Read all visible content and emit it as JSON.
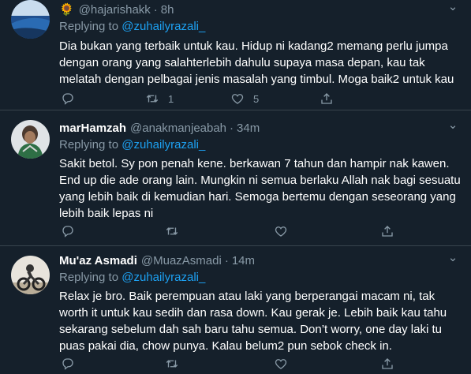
{
  "tweets": [
    {
      "emoji": "🌻",
      "name": "",
      "handle": "@hajarishakk",
      "time": "8h",
      "replying_prefix": "Replying to ",
      "replying_to": "@zuhailyrazali_",
      "text": "Dia bukan yang terbaik untuk kau. Hidup ni kadang2 memang perlu jumpa dengan orang yang salahterlebih dahulu supaya masa depan, kau tak melatah dengan pelbagai jenis masalah yang timbul. Moga baik2 untuk kau",
      "retweets": "1",
      "likes": "5"
    },
    {
      "name": "marHamzah",
      "handle": "@anakmanjeabah",
      "time": "34m",
      "replying_prefix": "Replying to ",
      "replying_to": "@zuhailyrazali_",
      "text": "Sakit betol. Sy pon penah kene. berkawan 7 tahun dan hampir nak kawen. End up die ade orang lain. Mungkin ni semua berlaku Allah nak bagi sesuatu yang lebih baik di kemudian hari. Semoga bertemu dengan seseorang yang lebih baik lepas ni",
      "retweets": "",
      "likes": ""
    },
    {
      "name": "Mu'az Asmadi",
      "handle": "@MuazAsmadi",
      "time": "14m",
      "replying_prefix": "Replying to ",
      "replying_to": "@zuhailyrazali_",
      "text": "Relax je bro. Baik perempuan atau laki yang berperangai macam ni, tak worth it untuk kau sedih dan rasa down. Kau gerak je. Lebih baik kau tahu sekarang sebelum dah sah baru tahu semua. Don’t worry, one day laki tu puas pakai dia, chow punya. Kalau belum2 pun sebok check in.",
      "retweets": "",
      "likes": ""
    }
  ],
  "icons": {
    "more": "chevron-down-icon",
    "reply": "reply-icon",
    "retweet": "retweet-icon",
    "like": "heart-icon",
    "share": "share-icon"
  },
  "colors": {
    "background": "#15202b",
    "divider": "#38444d",
    "secondary_text": "#8899a6",
    "link": "#1da1f2"
  }
}
